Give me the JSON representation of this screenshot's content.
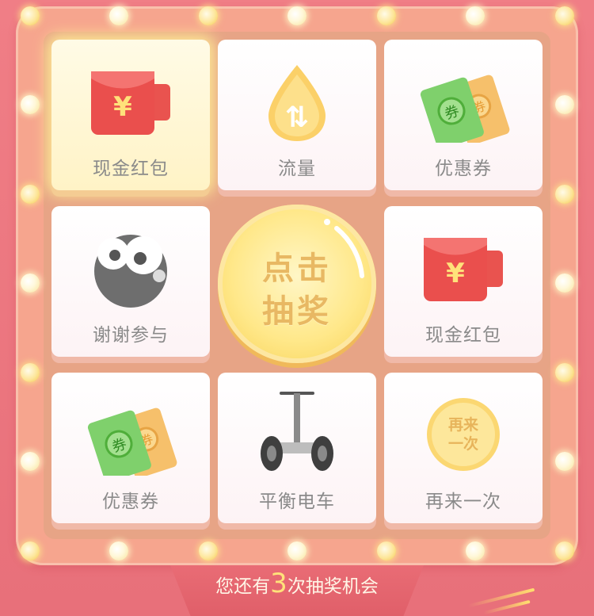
{
  "grid": [
    {
      "label": "现金红包",
      "icon": "red-envelope-icon",
      "active": true
    },
    {
      "label": "流量",
      "icon": "data-drop-icon",
      "active": false
    },
    {
      "label": "优惠券",
      "icon": "coupon-icon",
      "active": false
    },
    {
      "label": "谢谢参与",
      "icon": "sad-face-icon",
      "active": false
    },
    {
      "label": "现金红包",
      "icon": "red-envelope-icon",
      "active": false
    },
    {
      "label": "优惠券",
      "icon": "coupon-icon",
      "active": false
    },
    {
      "label": "平衡电车",
      "icon": "balance-scooter-icon",
      "active": false
    },
    {
      "label": "再来一次",
      "icon": "retry-coin-icon",
      "active": false
    }
  ],
  "icons": {
    "yuan": "¥",
    "data_arrows": "⇅",
    "coupon_mark": "券",
    "retry_text_1": "再来",
    "retry_text_2": "一次"
  },
  "center_button": {
    "line1": "点击",
    "line2": "抽奖"
  },
  "footer": {
    "prefix": "您还有",
    "count": "3",
    "suffix": "次抽奖机会"
  },
  "colors": {
    "background": "#f07e86",
    "frame": "#f6a58e",
    "panel": "#e7a486",
    "highlight": "#ffe27a"
  }
}
